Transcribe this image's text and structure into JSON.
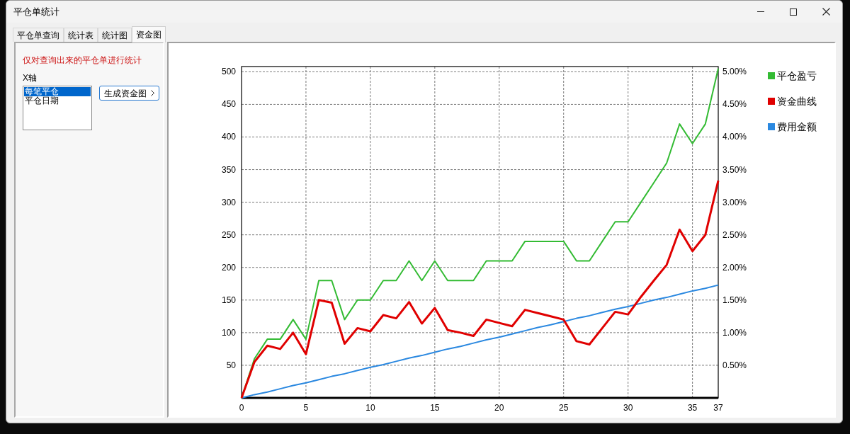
{
  "window": {
    "title": "平仓单统计"
  },
  "tabs": [
    {
      "label": "平仓单查询",
      "selected": false
    },
    {
      "label": "统计表",
      "selected": false
    },
    {
      "label": "统计图",
      "selected": false
    },
    {
      "label": "资金图",
      "selected": true
    }
  ],
  "sidebar": {
    "note": "仅对查询出来的平仓单进行统计",
    "x_axis_label": "X轴",
    "x_axis_options": [
      {
        "label": "每笔平仓",
        "selected": true
      },
      {
        "label": "平仓日期",
        "selected": false
      }
    ],
    "button": "生成资金图"
  },
  "chart": {
    "right_axis_labels": [
      "5.00%",
      "4.50%",
      "4.00%",
      "3.50%",
      "3.00%",
      "2.50%",
      "2.00%",
      "1.50%",
      "1.00%",
      "0.50%"
    ],
    "chart_data": {
      "type": "line",
      "x": [
        0,
        1,
        2,
        3,
        4,
        5,
        6,
        7,
        8,
        9,
        10,
        11,
        12,
        13,
        14,
        15,
        16,
        17,
        18,
        19,
        20,
        21,
        22,
        23,
        24,
        25,
        26,
        27,
        28,
        29,
        30,
        31,
        32,
        33,
        34,
        35,
        36,
        37
      ],
      "series": [
        {
          "name": "平仓盈亏",
          "color": "#33bb33",
          "values": [
            0,
            60,
            90,
            90,
            120,
            90,
            180,
            180,
            120,
            150,
            150,
            180,
            180,
            210,
            180,
            210,
            180,
            180,
            180,
            210,
            210,
            210,
            240,
            240,
            240,
            240,
            210,
            210,
            240,
            270,
            270,
            300,
            330,
            360,
            420,
            390,
            420,
            505
          ]
        },
        {
          "name": "资金曲线",
          "color": "#e00000",
          "values": [
            0,
            55,
            80,
            75,
            100,
            67,
            150,
            146,
            83,
            107,
            102,
            127,
            122,
            147,
            114,
            138,
            104,
            100,
            95,
            120,
            115,
            110,
            135,
            130,
            125,
            120,
            87,
            82,
            107,
            132,
            128,
            155,
            180,
            204,
            258,
            225,
            250,
            333
          ]
        },
        {
          "name": "费用金额",
          "color": "#2a88e0",
          "values": [
            0,
            5,
            9,
            14,
            19,
            23,
            28,
            33,
            37,
            42,
            47,
            51,
            56,
            61,
            65,
            70,
            75,
            79,
            84,
            89,
            93,
            98,
            103,
            108,
            112,
            117,
            122,
            126,
            131,
            136,
            140,
            145,
            150,
            154,
            159,
            164,
            168,
            173
          ]
        }
      ],
      "grid": true,
      "legend": true,
      "xlim": [
        0,
        37
      ],
      "ylim": [
        0,
        508
      ],
      "xticks": [
        0,
        5,
        10,
        15,
        20,
        25,
        30,
        35,
        37
      ],
      "yticks": [
        50,
        100,
        150,
        200,
        250,
        300,
        350,
        400,
        450,
        500
      ]
    }
  }
}
